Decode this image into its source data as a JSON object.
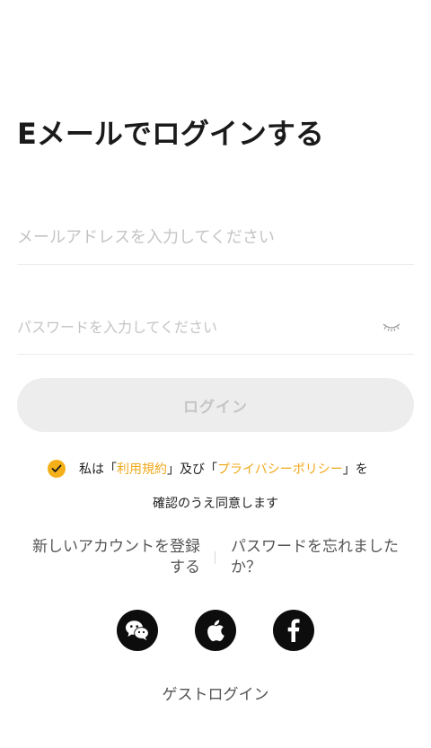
{
  "header": {
    "title": "Eメールでログインする"
  },
  "form": {
    "email_placeholder": "メールアドレスを入力してください",
    "password_placeholder": "パスワードを入力してください",
    "password_toggle_icon": "eye-closed-icon",
    "login_label": "ログイン"
  },
  "agreement": {
    "checked": true,
    "text_prefix": "私は「",
    "terms_label": "利用規約",
    "text_middle": "」及び「",
    "privacy_label": "プライバシーポリシー",
    "text_suffix": "」を",
    "text_line2": "確認のうえ同意します"
  },
  "links": {
    "register_line1": "新しいアカウントを登録",
    "register_line2": "する",
    "forgot_line1": "パスワードを忘れました",
    "forgot_line2": "か？"
  },
  "social": [
    {
      "icon": "wechat-icon"
    },
    {
      "icon": "apple-icon"
    },
    {
      "icon": "facebook-icon"
    }
  ],
  "guest_label": "ゲストログイン",
  "colors": {
    "accent": "#f4b019",
    "link": "#f0a81a",
    "button_disabled_bg": "#ededed",
    "button_disabled_text": "#c5c5c5",
    "social_bg": "#0d0d0d"
  }
}
